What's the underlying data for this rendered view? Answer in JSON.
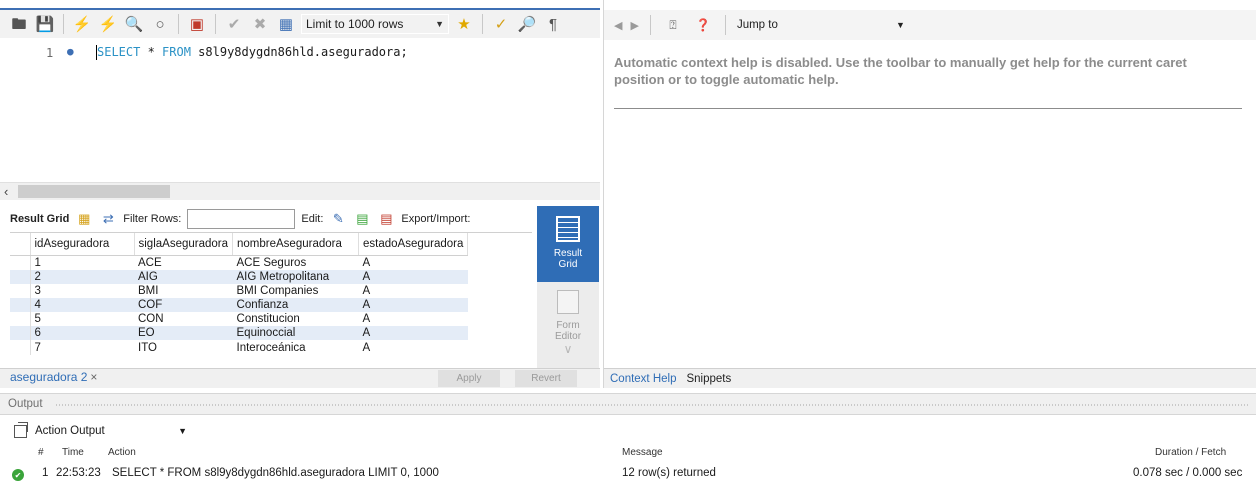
{
  "toolbar": {
    "limit_label": "Limit to 1000 rows"
  },
  "editor": {
    "line_number": "1",
    "sql_keyword1": "SELECT",
    "sql_mid": " * ",
    "sql_keyword2": "FROM",
    "sql_rest": " s8l9y8dygdn86hld.aseguradora;"
  },
  "result_toolbar": {
    "result_grid": "Result Grid",
    "filter_rows": "Filter Rows:",
    "edit": "Edit:",
    "export_import": "Export/Import:"
  },
  "grid": {
    "columns": [
      "idAseguradora",
      "siglaAseguradora",
      "nombreAseguradora",
      "estadoAseguradora"
    ],
    "rows": [
      [
        "1",
        "ACE",
        "ACE Seguros",
        "A"
      ],
      [
        "2",
        "AIG",
        "AIG Metropolitana",
        "A"
      ],
      [
        "3",
        "BMI",
        "BMI Companies",
        "A"
      ],
      [
        "4",
        "COF",
        "Confianza",
        "A"
      ],
      [
        "5",
        "CON",
        "Constitucion",
        "A"
      ],
      [
        "6",
        "EO",
        "Equinoccial",
        "A"
      ],
      [
        "7",
        "ITO",
        "Interoceánica",
        "A"
      ]
    ]
  },
  "side_panel": {
    "result_grid": "Result Grid",
    "form_editor": "Form Editor"
  },
  "tabs": {
    "query_tab": "aseguradora 2",
    "apply": "Apply",
    "revert": "Revert"
  },
  "right_pane": {
    "jump_to": "Jump to",
    "help_text": "Automatic context help is disabled. Use the toolbar to manually get help for the current caret position or to toggle automatic help.",
    "tab_context_help": "Context Help",
    "tab_snippets": "Snippets"
  },
  "output": {
    "title": "Output",
    "action_output": "Action Output",
    "headers": {
      "num": "#",
      "time": "Time",
      "action": "Action",
      "message": "Message",
      "duration": "Duration / Fetch"
    },
    "log": [
      {
        "num": "1",
        "time": "22:53:23",
        "action": "SELECT * FROM s8l9y8dygdn86hld.aseguradora LIMIT 0, 1000",
        "message": "12 row(s) returned",
        "duration": "0.078 sec / 0.000 sec"
      }
    ]
  },
  "colors": {
    "accent": "#2f6db6",
    "sql_keyword": "#2b92c6",
    "grid_alt_row": "#e4ecf7",
    "success": "#3aa43a"
  }
}
